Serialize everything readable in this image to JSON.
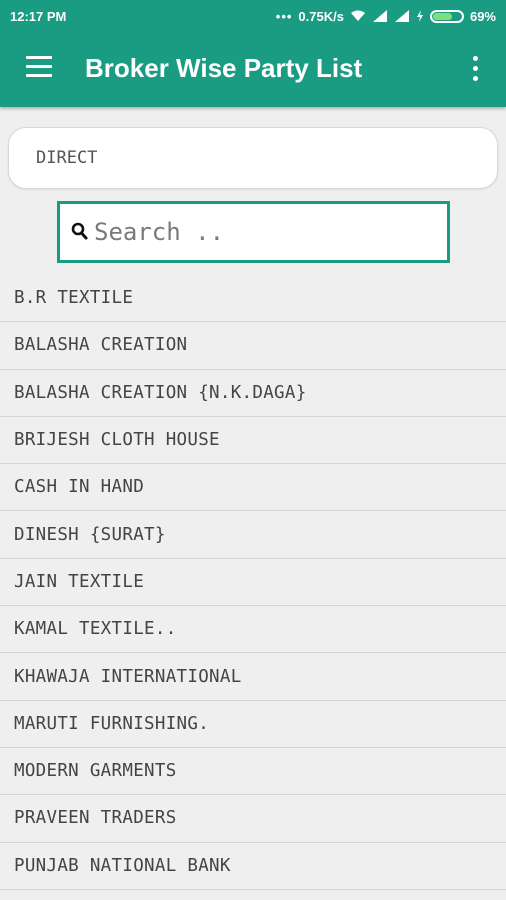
{
  "status_bar": {
    "time": "12:17 PM",
    "network_speed": "0.75K/s",
    "battery_percent": "69%",
    "battery_level": 0.69
  },
  "app_bar": {
    "title": "Broker Wise Party List"
  },
  "broker": {
    "value": "DIRECT"
  },
  "search": {
    "placeholder": "Search .."
  },
  "colors": {
    "primary": "#1a9c83",
    "background": "#efefef"
  },
  "party_list": [
    "B.R TEXTILE",
    "BALASHA CREATION",
    "BALASHA CREATION {N.K.DAGA}",
    "BRIJESH CLOTH HOUSE",
    "CASH IN HAND",
    "DINESH {SURAT}",
    "JAIN TEXTILE",
    "KAMAL TEXTILE..",
    "KHAWAJA INTERNATIONAL",
    "MARUTI FURNISHING.",
    "MODERN GARMENTS",
    "PRAVEEN TRADERS",
    "PUNJAB NATIONAL BANK"
  ]
}
